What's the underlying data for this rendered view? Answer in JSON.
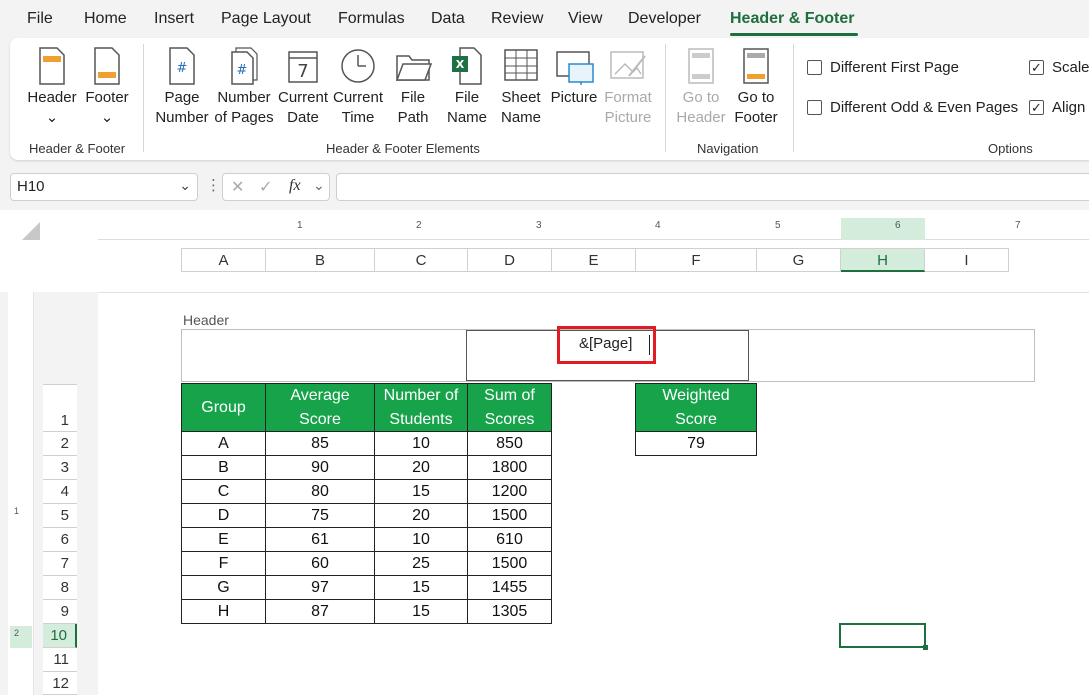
{
  "menu": {
    "items": [
      "File",
      "Home",
      "Insert",
      "Page Layout",
      "Formulas",
      "Data",
      "Review",
      "View",
      "Developer",
      "Header & Footer"
    ],
    "active": "Header & Footer"
  },
  "ribbon": {
    "groups": {
      "header_footer": {
        "label": "Header & Footer",
        "buttons": [
          {
            "label": "Header",
            "icon": "header-icon"
          },
          {
            "label": "Footer",
            "icon": "footer-icon"
          }
        ]
      },
      "elements": {
        "label": "Header & Footer Elements",
        "buttons": [
          {
            "line1": "Page",
            "line2": "Number",
            "icon": "page-number-icon"
          },
          {
            "line1": "Number",
            "line2": "of Pages",
            "icon": "number-of-pages-icon"
          },
          {
            "line1": "Current",
            "line2": "Date",
            "icon": "calendar-icon"
          },
          {
            "line1": "Current",
            "line2": "Time",
            "icon": "clock-icon"
          },
          {
            "line1": "File",
            "line2": "Path",
            "icon": "folder-icon"
          },
          {
            "line1": "File",
            "line2": "Name",
            "icon": "excel-file-icon"
          },
          {
            "line1": "Sheet",
            "line2": "Name",
            "icon": "grid-icon"
          },
          {
            "line1": "Picture",
            "line2": "",
            "icon": "picture-icon"
          },
          {
            "line1": "Format",
            "line2": "Picture",
            "icon": "format-picture-icon"
          }
        ]
      },
      "navigation": {
        "label": "Navigation",
        "buttons": [
          {
            "line1": "Go to",
            "line2": "Header",
            "icon": "go-to-header-icon"
          },
          {
            "line1": "Go to",
            "line2": "Footer",
            "icon": "go-to-footer-icon"
          }
        ]
      },
      "options": {
        "label": "Options",
        "checkboxes": [
          {
            "label": "Different First Page",
            "checked": false
          },
          {
            "label": "Different Odd & Even Pages",
            "checked": false
          },
          {
            "label": "Scale",
            "checked": true
          },
          {
            "label": "Align",
            "checked": true
          }
        ]
      }
    }
  },
  "formula_bar": {
    "name_box": "H10",
    "fx_label": "fx",
    "formula": ""
  },
  "ruler": {
    "numbers": [
      "1",
      "2",
      "3",
      "4",
      "5",
      "6",
      "7"
    ],
    "left_numbers": [
      "1",
      "2"
    ]
  },
  "columns": [
    "A",
    "B",
    "C",
    "D",
    "E",
    "F",
    "G",
    "H",
    "I"
  ],
  "selected_column": "H",
  "rows": [
    "1",
    "2",
    "3",
    "4",
    "5",
    "6",
    "7",
    "8",
    "9",
    "10",
    "11",
    "12"
  ],
  "selected_row": "10",
  "header_area": {
    "label": "Header",
    "center_code": "&[Page]"
  },
  "table": {
    "headers": [
      [
        "Group"
      ],
      [
        "Average",
        "Score"
      ],
      [
        "Number of",
        "Students"
      ],
      [
        "Sum of",
        "Scores"
      ]
    ],
    "rows": [
      [
        "A",
        "85",
        "10",
        "850"
      ],
      [
        "B",
        "90",
        "20",
        "1800"
      ],
      [
        "C",
        "80",
        "15",
        "1200"
      ],
      [
        "D",
        "75",
        "20",
        "1500"
      ],
      [
        "E",
        "61",
        "10",
        "610"
      ],
      [
        "F",
        "60",
        "25",
        "1500"
      ],
      [
        "G",
        "97",
        "15",
        "1455"
      ],
      [
        "H",
        "87",
        "15",
        "1305"
      ]
    ]
  },
  "weighted": {
    "header": [
      "Weighted",
      "Score"
    ],
    "value": "79"
  },
  "colors": {
    "accent": "#1e6e3e",
    "table_header": "#17a34a",
    "highlight": "#e01b24"
  }
}
